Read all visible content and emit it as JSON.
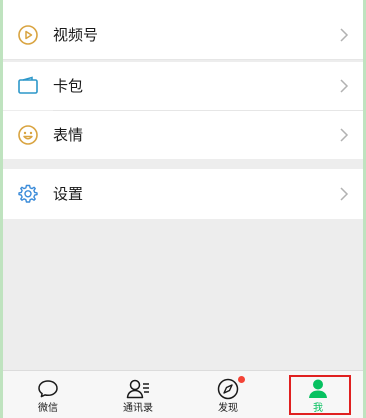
{
  "menu": {
    "channels_label": "视频号",
    "cards_label": "卡包",
    "stickers_label": "表情",
    "settings_label": "设置"
  },
  "tabs": {
    "chats": "微信",
    "contacts": "通讯录",
    "discover": "发现",
    "me": "我"
  },
  "colors": {
    "accent": "#07c160",
    "channels_icon": "#d9a441",
    "cards_icon": "#2c97c9",
    "stickers_icon": "#d9a441",
    "settings_icon": "#3a8bd9",
    "badge": "#f44336",
    "highlight": "#e02020"
  },
  "icons": {
    "channels": "play-circle-icon",
    "cards": "card-icon",
    "stickers": "smile-icon",
    "settings": "gear-icon",
    "chevron": "chevron-right-icon",
    "chats": "chat-bubble-icon",
    "contacts": "contacts-icon",
    "discover": "compass-icon",
    "me": "person-icon"
  }
}
